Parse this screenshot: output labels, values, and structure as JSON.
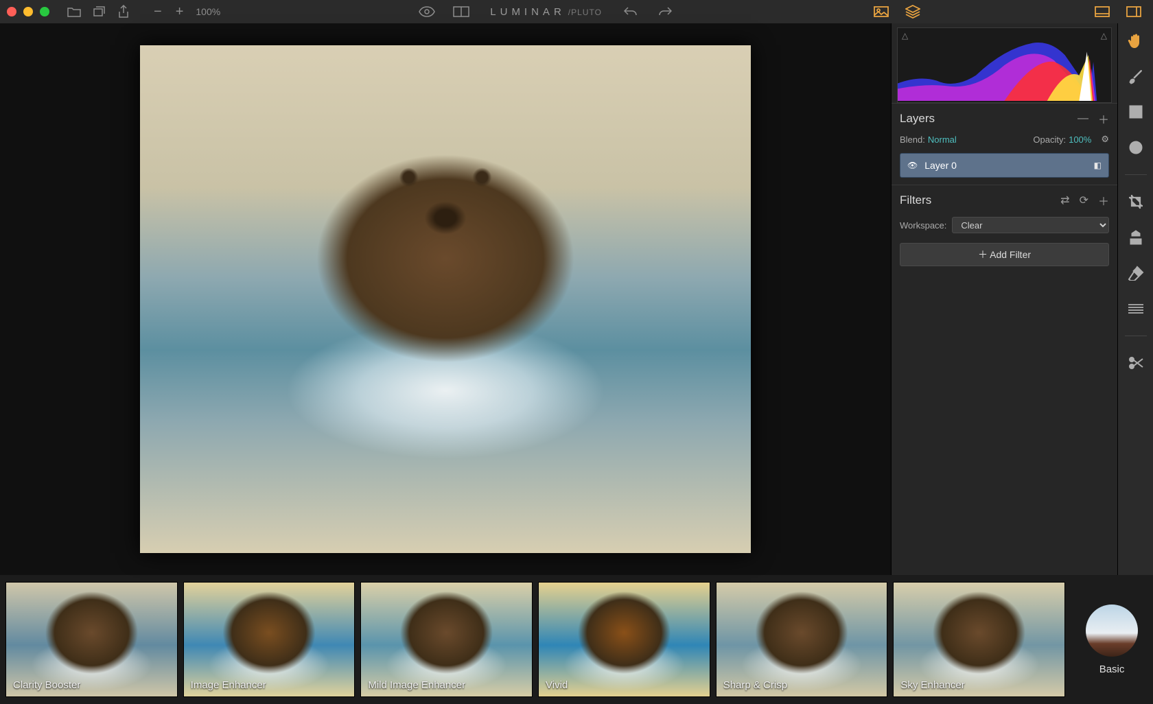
{
  "titlebar": {
    "app_name": "LUMINAR",
    "doc_name": "/PLUTO",
    "zoom_value": "100%"
  },
  "side": {
    "layers_title": "Layers",
    "blend_label": "Blend:",
    "blend_value": "Normal",
    "opacity_label": "Opacity:",
    "opacity_value": "100%",
    "layer0_name": "Layer 0",
    "filters_title": "Filters",
    "workspace_label": "Workspace:",
    "workspace_value": "Clear",
    "add_filter_label": "＋  Add Filter"
  },
  "presets": [
    {
      "label": "Clarity Booster"
    },
    {
      "label": "Image Enhancer"
    },
    {
      "label": "Mild Image Enhancer"
    },
    {
      "label": "Vivid"
    },
    {
      "label": "Sharp & Crisp"
    },
    {
      "label": "Sky Enhancer"
    }
  ],
  "preset_category": "Basic"
}
